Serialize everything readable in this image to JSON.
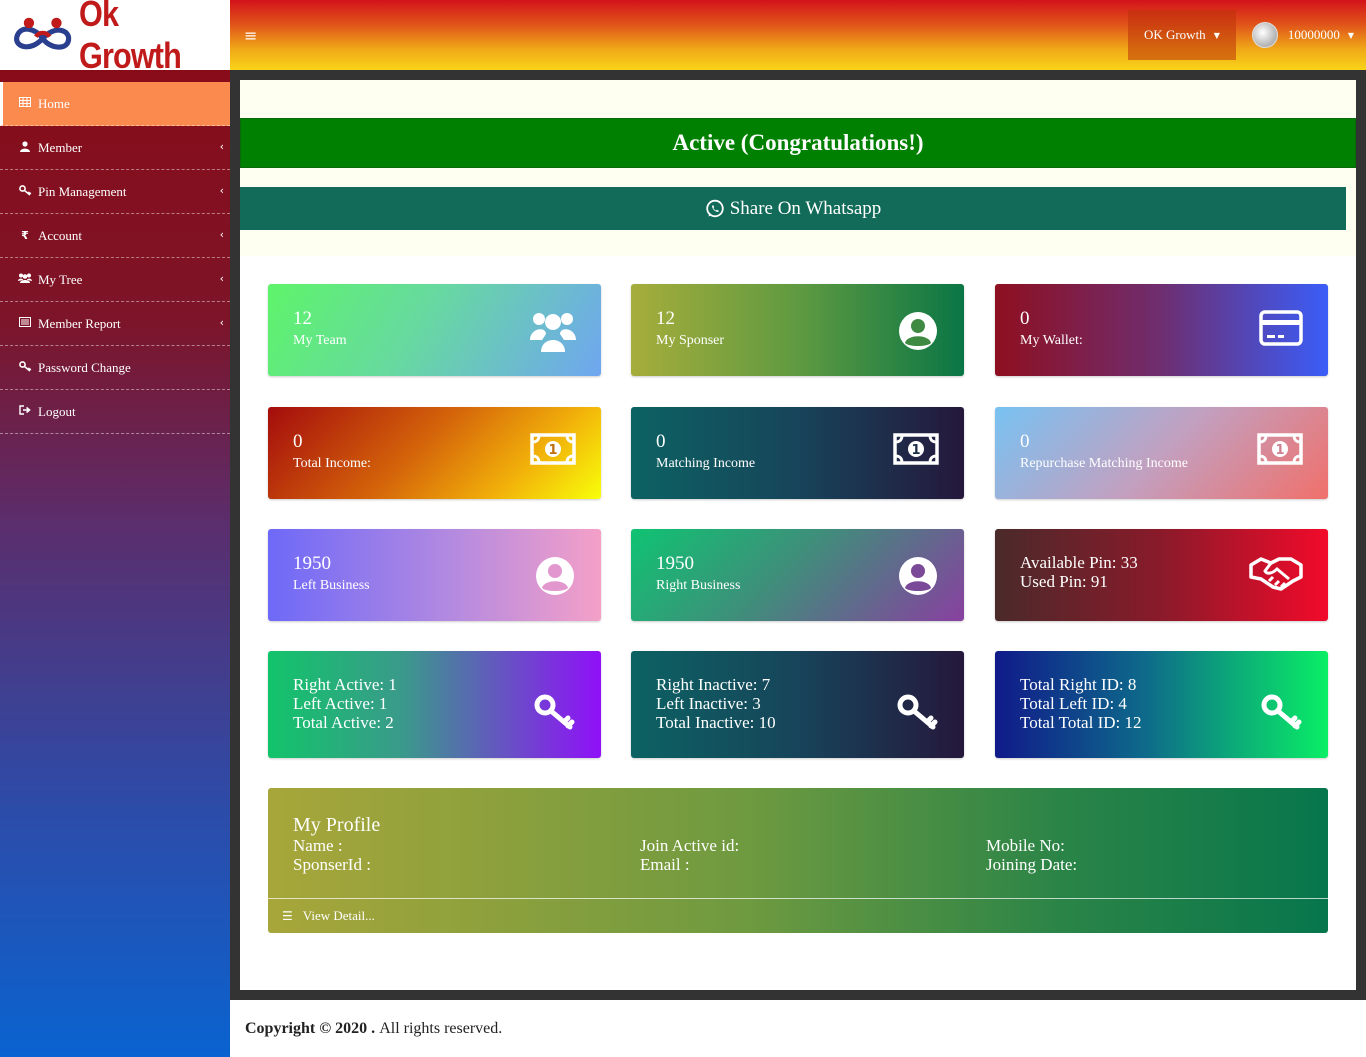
{
  "brand": {
    "name": "Ok Growth"
  },
  "header": {
    "menu_icon": "bars-icon",
    "org_label": "OK Growth",
    "user_id": "10000000"
  },
  "sidebar": {
    "items": [
      {
        "label": "Home",
        "icon": "table-icon",
        "active": true
      },
      {
        "label": "Member",
        "icon": "user-icon"
      },
      {
        "label": "Pin Management",
        "icon": "key-icon"
      },
      {
        "label": "Account",
        "icon": "rupee-icon"
      },
      {
        "label": "My Tree",
        "icon": "users-icon"
      },
      {
        "label": "Member Report",
        "icon": "list-icon"
      },
      {
        "label": "Password Change",
        "icon": "key-icon"
      },
      {
        "label": "Logout",
        "icon": "sign-out-icon"
      }
    ]
  },
  "status": {
    "active_text": "Active (Congratulations!)",
    "share_label": "Share On Whatsapp"
  },
  "cards": [
    {
      "num": "12",
      "label": "My Team",
      "icon": "users-icon"
    },
    {
      "num": "12",
      "label": "My Sponser",
      "icon": "user-circle-icon"
    },
    {
      "num": "0",
      "label": "My Wallet:",
      "icon": "credit-card-icon"
    },
    {
      "num": "0",
      "label": "Total Income:",
      "icon": "money-bill-icon"
    },
    {
      "num": "0",
      "label": "Matching Income",
      "icon": "money-bill-icon"
    },
    {
      "num": "0",
      "label": "Repurchase Matching Income",
      "icon": "money-bill-icon"
    },
    {
      "num": "1950",
      "label": "Left Business",
      "icon": "user-circle-icon"
    },
    {
      "num": "1950",
      "label": "Right Business",
      "icon": "user-circle-icon"
    },
    {
      "lines": [
        "Available Pin: 33",
        "Used Pin: 91"
      ],
      "icon": "handshake-icon"
    },
    {
      "lines": [
        "Right Active: 1",
        "Left Active: 1",
        "Total Active: 2"
      ],
      "icon": "key-icon"
    },
    {
      "lines": [
        "Right Inactive: 7",
        "Left Inactive: 3",
        "Total Inactive: 10"
      ],
      "icon": "key-icon"
    },
    {
      "lines": [
        "Total Right ID: 8",
        "Total Left ID: 4",
        "Total Total ID: 12"
      ],
      "icon": "key-icon"
    }
  ],
  "profile": {
    "title": "My Profile",
    "name_label": "Name :",
    "sponser_label": "SponserId :",
    "join_label": "Join Active id:",
    "email_label": "Email :",
    "mobile_label": "Mobile No:",
    "joining_label": "Joining Date:",
    "view_detail": "View Detail..."
  },
  "footer": {
    "copyright": "Copyright © 2020 .",
    "rights": "All rights reserved."
  },
  "colors": {
    "active_green": "#008000",
    "whatsapp": "#116b58",
    "home_active": "#fb8a4e"
  }
}
